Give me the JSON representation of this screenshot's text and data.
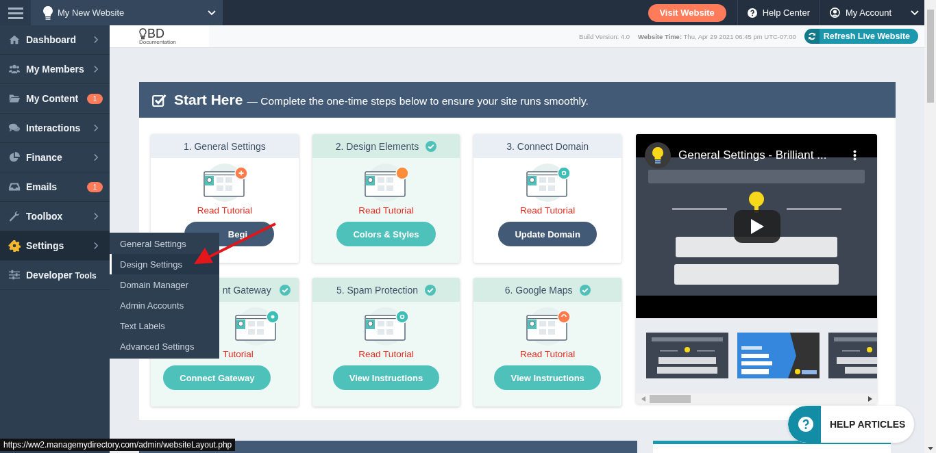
{
  "top_bar": {
    "site_name": "My New Website",
    "visit_button": "Visit Website",
    "help": "Help Center",
    "account": "My Account"
  },
  "sidebar": {
    "items": [
      {
        "label": "Dashboard",
        "submenu": true,
        "selected": false
      },
      {
        "label": "My Members",
        "submenu": true,
        "selected": false
      },
      {
        "label": "My Content",
        "badge": "1",
        "submenu": false,
        "selected": false
      },
      {
        "label": "Interactions",
        "submenu": true,
        "selected": false
      },
      {
        "label": "Finance",
        "submenu": true,
        "selected": false
      },
      {
        "label": "Emails",
        "badge": "1",
        "submenu": false,
        "selected": false
      },
      {
        "label": "Toolbox",
        "submenu": true,
        "selected": false
      },
      {
        "label": "Settings",
        "submenu": true,
        "selected": true
      },
      {
        "label": "Developer",
        "suffix": "Tools",
        "submenu": false,
        "selected": false
      }
    ]
  },
  "header": {
    "logo": "BD",
    "logo_caption": "Documentation",
    "build_label": "Build Version:",
    "build": "4.0",
    "time_label": "Website Time:",
    "time": "Thu, Apr 29 2021 06:45 pm UTC-07:00",
    "refresh_button": "Refresh Live Website"
  },
  "start_here": {
    "title": "Start Here",
    "subtitle": "— Complete the one-time steps below to ensure your site runs smoothly.",
    "steps": [
      {
        "title": "1. General Settings",
        "done": false,
        "link": "Read Tutorial",
        "button": "Begi"
      },
      {
        "title": "2. Design Elements",
        "done": true,
        "link": "Read Tutorial",
        "button": "Colors & Styles"
      },
      {
        "title": "3. Connect Domain",
        "done": false,
        "link": "Read Tutorial",
        "button": "Update Domain"
      },
      {
        "title": "nt Gateway",
        "done": true,
        "link": "Tutorial",
        "button": "Connect Gateway"
      },
      {
        "title": "5. Spam Protection",
        "done": true,
        "link": "Read Tutorial",
        "button": "View Instructions"
      },
      {
        "title": "6. Google Maps",
        "done": true,
        "link": "Read Tutorial",
        "button": "View Instructions"
      }
    ],
    "video": {
      "title": "General Settings - Brilliant ...",
      "kind": "picture"
    }
  },
  "flyout": {
    "items": [
      {
        "label": "General Settings",
        "selected": false
      },
      {
        "label": "Design Settings",
        "selected": true
      },
      {
        "label": "Domain Manager",
        "selected": false
      },
      {
        "label": "Admin Accounts",
        "selected": false
      },
      {
        "label": "Text Labels",
        "selected": false
      },
      {
        "label": "Advanced Settings",
        "selected": false
      }
    ]
  },
  "help_button": "HELP ARTICLES",
  "status_url": "https://ww2.managemydirectory.com/admin/websiteLayout.php"
}
